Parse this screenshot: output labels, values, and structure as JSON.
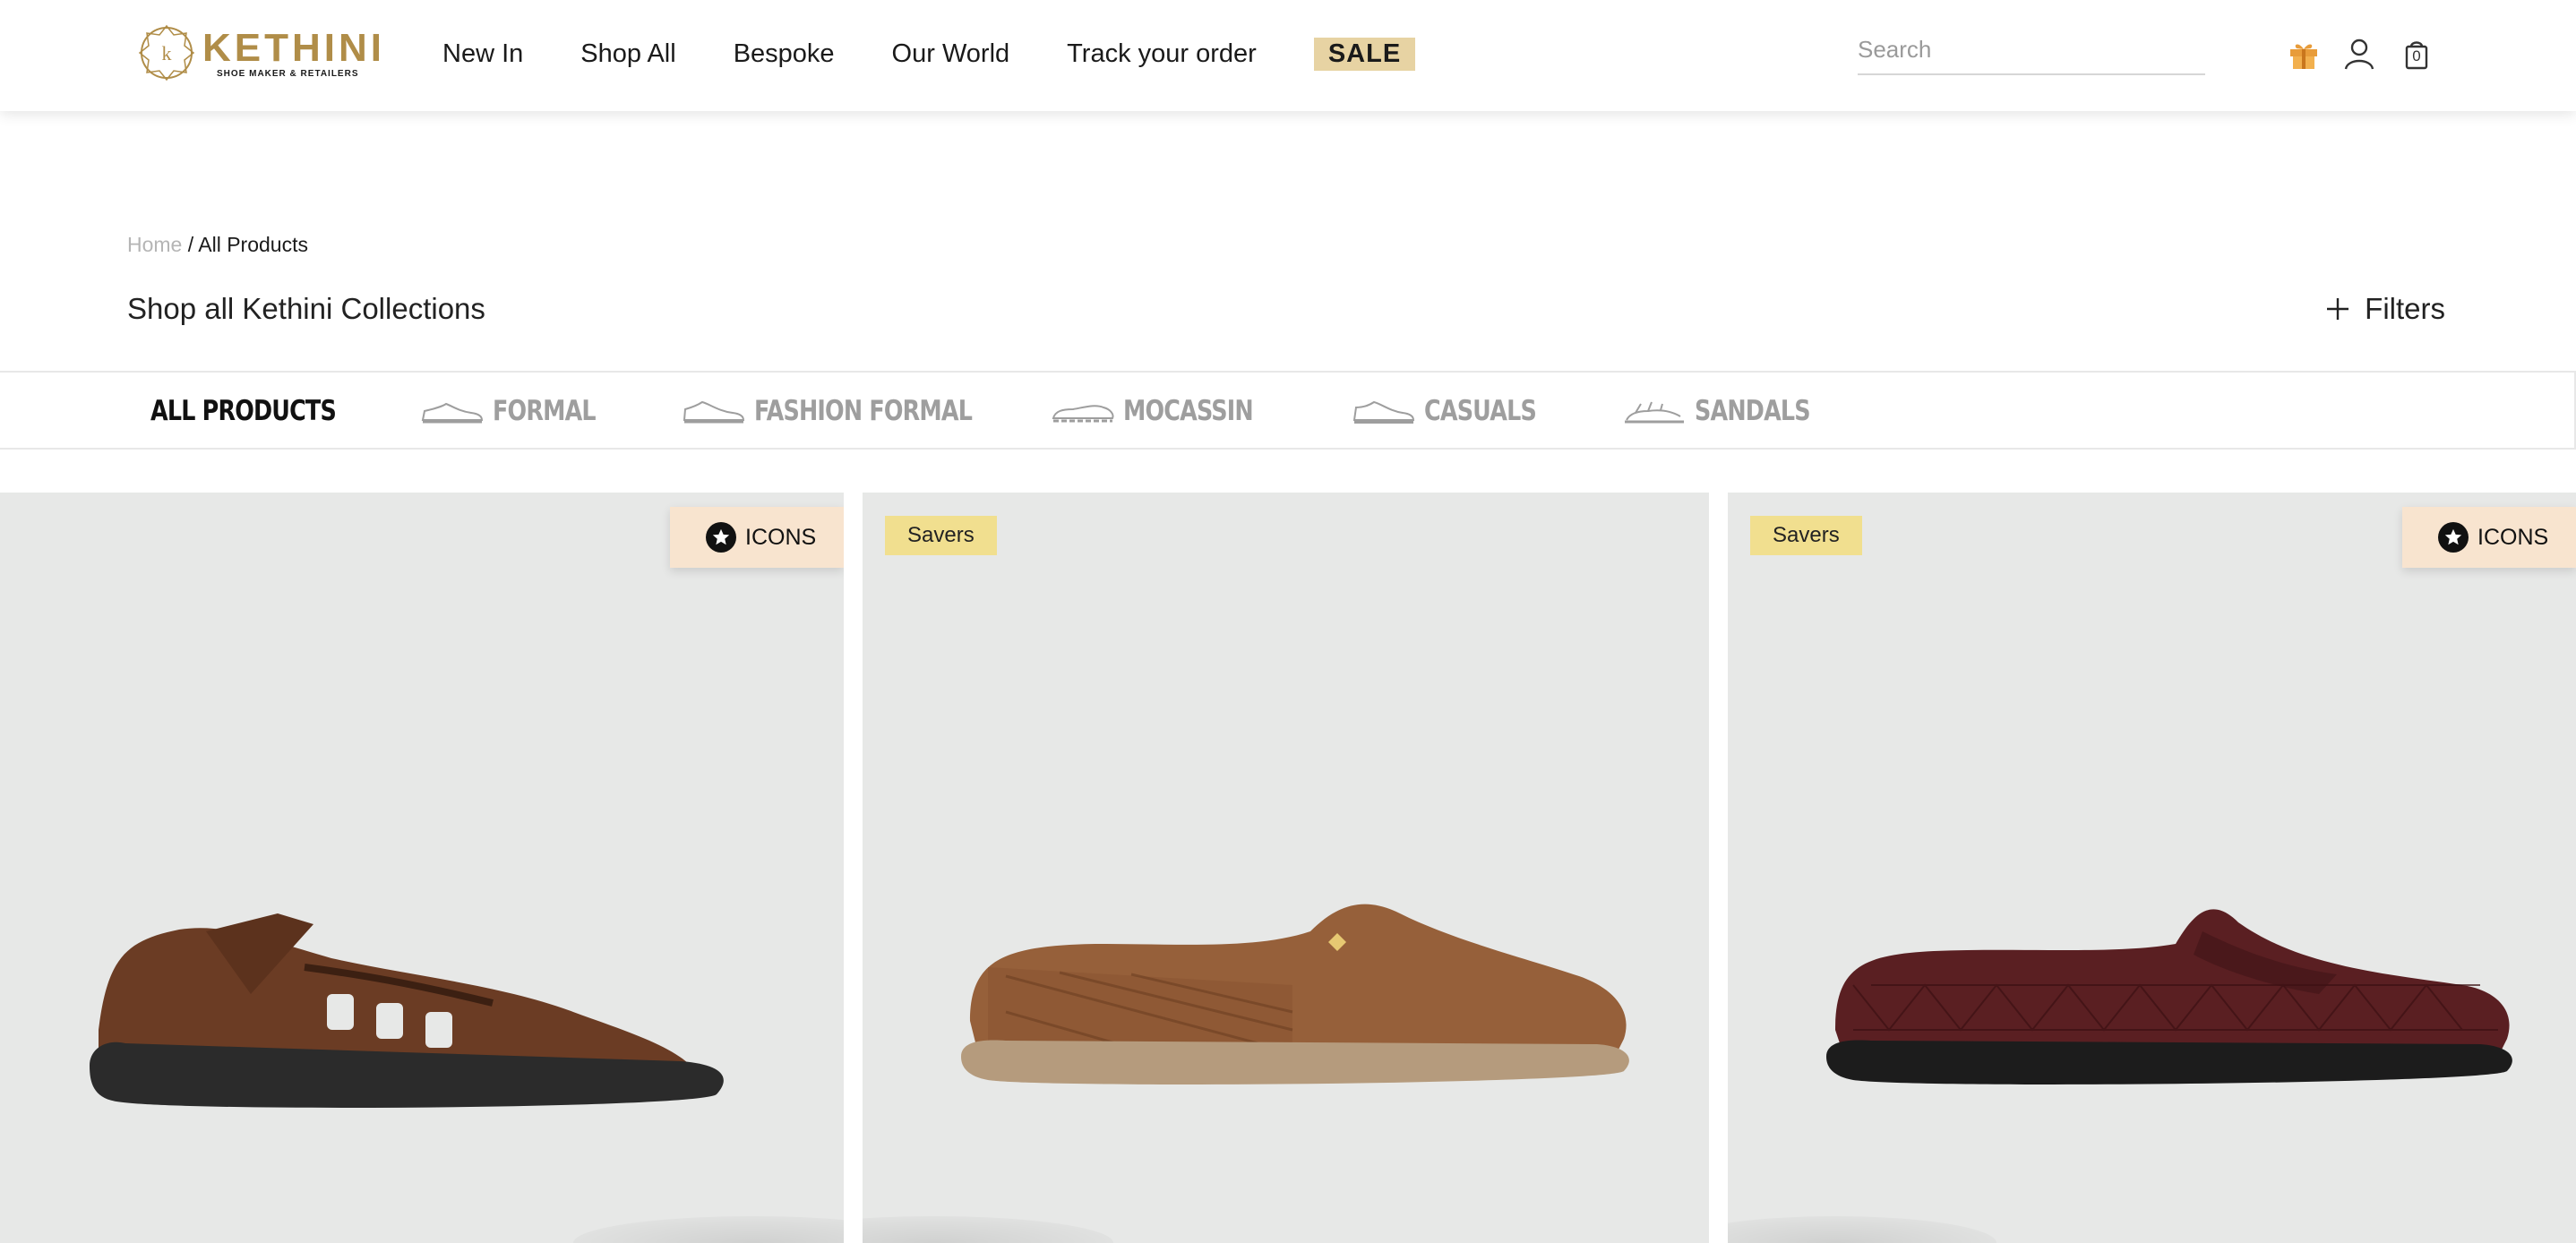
{
  "brand": {
    "name": "KETHINI",
    "tagline": "SHOE MAKER & RETAILERS",
    "accent": "#b08d48"
  },
  "nav": {
    "items": [
      "New In",
      "Shop All",
      "Bespoke",
      "Our World",
      "Track your order"
    ],
    "sale": "SALE"
  },
  "search": {
    "placeholder": "Search",
    "value": ""
  },
  "header_icons": [
    "gift-icon",
    "user-icon",
    "bag-icon"
  ],
  "cart": {
    "count": "0"
  },
  "breadcrumb": {
    "home": "Home",
    "separator": " / ",
    "current": "All Products"
  },
  "page": {
    "title": "Shop all Kethini Collections",
    "filters_label": "Filters"
  },
  "categories": [
    {
      "label": "All Products",
      "active": true,
      "icon": ""
    },
    {
      "label": "Formal",
      "active": false,
      "icon": "formal-shoe-icon"
    },
    {
      "label": "Fashion Formal",
      "active": false,
      "icon": "fashion-formal-shoe-icon"
    },
    {
      "label": "Mocassin",
      "active": false,
      "icon": "mocassin-icon"
    },
    {
      "label": "Casuals",
      "active": false,
      "icon": "casual-shoe-icon"
    },
    {
      "label": "Sandals",
      "active": false,
      "icon": "sandal-icon"
    }
  ],
  "products": [
    {
      "badge": "ICONS",
      "badge_type": "icons",
      "shoe_color": "#6b3c24",
      "sole_color": "#2b2b2b"
    },
    {
      "badge": "Savers",
      "badge_type": "savers",
      "shoe_color": "#96603a",
      "sole_color": "#b59b7d"
    },
    {
      "badge": "Savers",
      "badge_type": "savers",
      "second_badge": "ICONS",
      "shoe_color": "#5a1f22",
      "sole_color": "#1c1c1c"
    }
  ]
}
